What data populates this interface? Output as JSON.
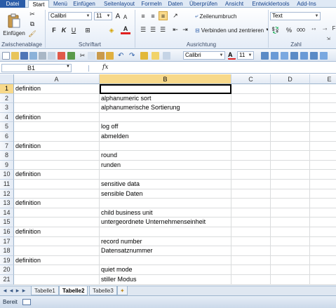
{
  "ribbon_tabs": [
    "Datei",
    "Start",
    "Menü",
    "Einfügen",
    "Seitenlayout",
    "Formeln",
    "Daten",
    "Überprüfen",
    "Ansicht",
    "Entwicklertools",
    "Add-Ins"
  ],
  "clipboard": {
    "paste_label": "Einfügen",
    "group_label": "Zwischenablage"
  },
  "font": {
    "name": "Calibri",
    "size": "11",
    "group_label": "Schriftart",
    "bold": "F",
    "italic": "K",
    "underline": "U"
  },
  "alignment": {
    "wrap_label": "Zeilenumbruch",
    "merge_label": "Verbinden und zentrieren",
    "group_label": "Ausrichtung"
  },
  "number": {
    "format": "Text",
    "percent": "%",
    "thousands": "000",
    "group_label": "Zahl"
  },
  "toolbar": {
    "font_name": "Calibri",
    "font_size": "11"
  },
  "formula_bar": {
    "name_box": "B1",
    "fx": "fx",
    "formula": ""
  },
  "columns": [
    "A",
    "B",
    "C",
    "D",
    "E"
  ],
  "rows": [
    {
      "num": "1",
      "a": "definition",
      "b": ""
    },
    {
      "num": "2",
      "a": "",
      "b": "alphanumeric sort"
    },
    {
      "num": "3",
      "a": "",
      "b": "alphanumerische Sortierung"
    },
    {
      "num": "4",
      "a": "definition",
      "b": ""
    },
    {
      "num": "5",
      "a": "",
      "b": "log off"
    },
    {
      "num": "6",
      "a": "",
      "b": "abmelden"
    },
    {
      "num": "7",
      "a": "definition",
      "b": ""
    },
    {
      "num": "8",
      "a": "",
      "b": "round"
    },
    {
      "num": "9",
      "a": "",
      "b": "runden"
    },
    {
      "num": "10",
      "a": "definition",
      "b": ""
    },
    {
      "num": "11",
      "a": "",
      "b": "sensitive data"
    },
    {
      "num": "12",
      "a": "",
      "b": "sensible Daten"
    },
    {
      "num": "13",
      "a": "definition",
      "b": ""
    },
    {
      "num": "14",
      "a": "",
      "b": "child business unit"
    },
    {
      "num": "15",
      "a": "",
      "b": "untergeordnete Unternehmenseinheit"
    },
    {
      "num": "16",
      "a": "definition",
      "b": ""
    },
    {
      "num": "17",
      "a": "",
      "b": "record number"
    },
    {
      "num": "18",
      "a": "",
      "b": "Datensatznummer"
    },
    {
      "num": "19",
      "a": "definition",
      "b": ""
    },
    {
      "num": "20",
      "a": "",
      "b": "quiet mode"
    },
    {
      "num": "21",
      "a": "",
      "b": "stiller Modus"
    }
  ],
  "sheets": [
    "Tabelle1",
    "Tabelle2",
    "Tabelle3"
  ],
  "active_sheet": "Tabelle2",
  "status_text": "Bereit",
  "colors": {
    "selection_header": "#f8d98a",
    "file_tab": "#2a5ca8"
  }
}
